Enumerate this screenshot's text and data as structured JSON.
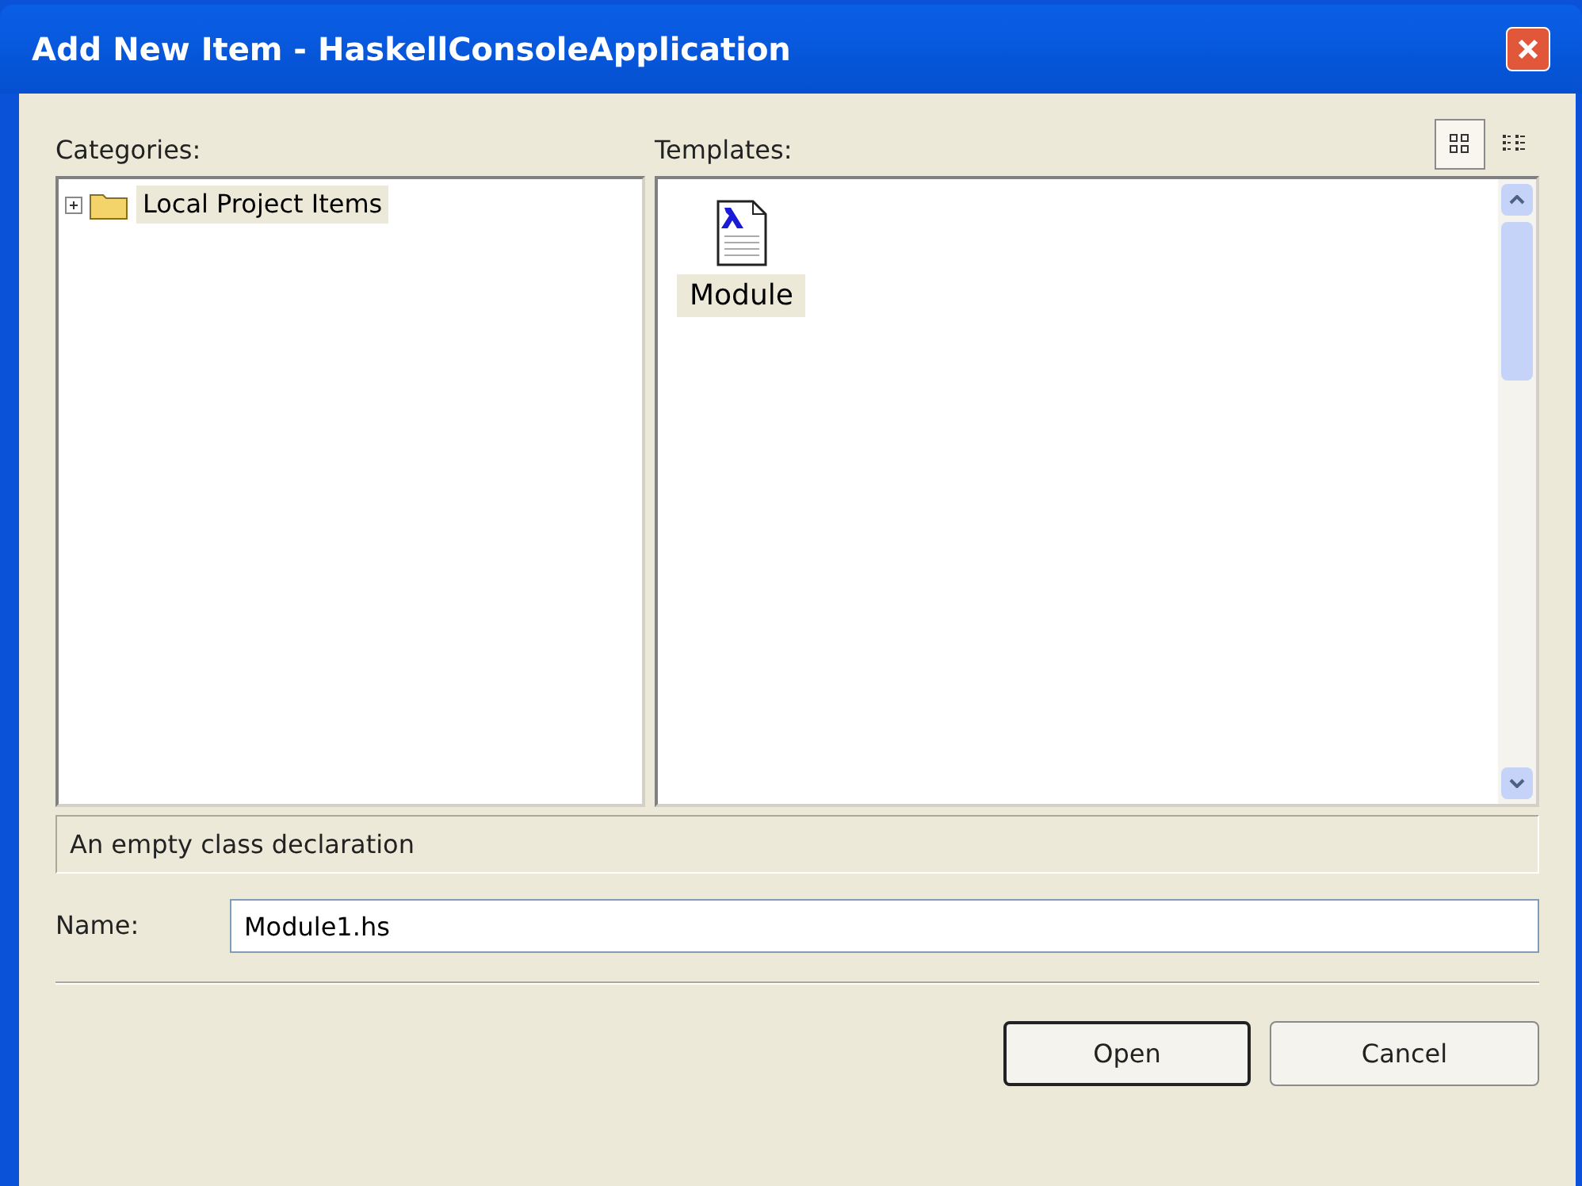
{
  "window": {
    "title": "Add New Item - HaskellConsoleApplication"
  },
  "categories": {
    "label": "Categories:",
    "items": [
      {
        "label": "Local Project Items",
        "expanded": false,
        "selected": true
      }
    ]
  },
  "templates": {
    "label": "Templates:",
    "view_modes": [
      {
        "kind": "large",
        "selected": true
      },
      {
        "kind": "small",
        "selected": false
      }
    ],
    "items": [
      {
        "label": "Module",
        "selected": true
      }
    ]
  },
  "description": "An empty class declaration",
  "name_field": {
    "label": "Name:",
    "value": "Module1.hs"
  },
  "buttons": [
    {
      "label": "Open",
      "default": true
    },
    {
      "label": "Cancel",
      "default": false
    }
  ]
}
